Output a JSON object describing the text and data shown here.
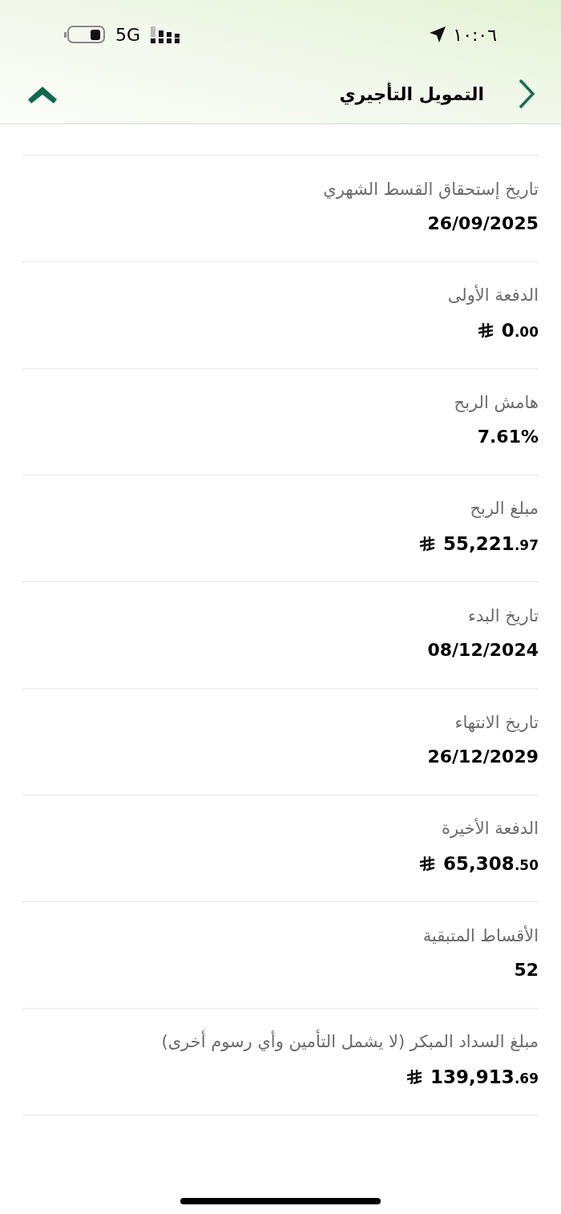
{
  "status_bar": {
    "time": "١٠:٠٦",
    "network": "5G"
  },
  "header": {
    "title": "التمويل التأجيري"
  },
  "rows": [
    {
      "kind": "text",
      "label": "تاريخ إستحقاق القسط الشهري",
      "value": "26/09/2025"
    },
    {
      "kind": "money",
      "label": "الدفعة الأولى",
      "integer": "0",
      "decimals": ".00"
    },
    {
      "kind": "text",
      "label": "هامش الربح",
      "value": "7.61%"
    },
    {
      "kind": "money",
      "label": "مبلغ الربح",
      "integer": "55,221",
      "decimals": ".97"
    },
    {
      "kind": "text",
      "label": "تاريخ البدء",
      "value": "08/12/2024"
    },
    {
      "kind": "text",
      "label": "تاريخ الانتهاء",
      "value": "26/12/2029"
    },
    {
      "kind": "money",
      "label": "الدفعة الأخيرة",
      "integer": "65,308",
      "decimals": ".50"
    },
    {
      "kind": "text",
      "label": "الأقساط المتبقية",
      "value": "52"
    },
    {
      "kind": "money",
      "label": "مبلغ السداد المبكر (لا يشمل التأمين وأي رسوم أخرى)",
      "integer": "139,913",
      "decimals": ".69"
    }
  ]
}
